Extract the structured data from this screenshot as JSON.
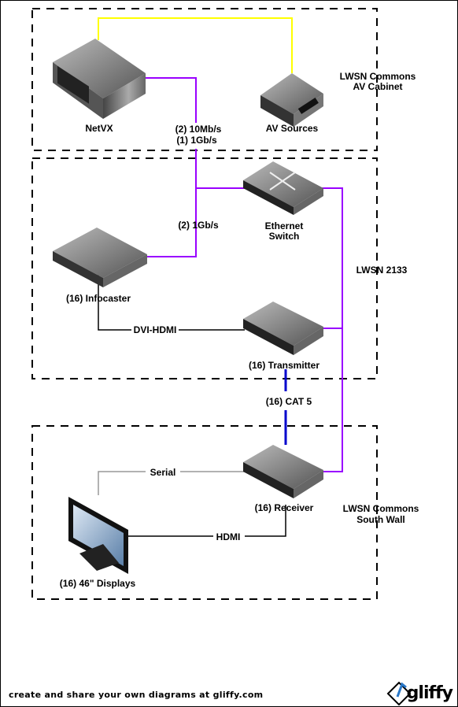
{
  "zones": {
    "av_cabinet": [
      "LWSN Commons",
      "AV Cabinet"
    ],
    "room_2133": "LWSN 2133",
    "south_wall": [
      "LWSN Commons",
      "South Wall"
    ]
  },
  "devices": {
    "netvx": "NetVX",
    "av_sources": "AV Sources",
    "ethernet_switch": [
      "Ethernet",
      "Switch"
    ],
    "infocaster": "(16)  Infocaster",
    "transmitter": "(16)  Transmitter",
    "receiver": "(16)  Receiver",
    "displays": "(16)  46\" Displays"
  },
  "connections": {
    "netvx_link": [
      "(2)  10Mb/s",
      "(1)  1Gb/s"
    ],
    "infocaster_link": "(2)  1Gb/s",
    "dvi_hdmi": "DVI-HDMI",
    "cat5": "(16)  CAT 5",
    "serial": "Serial",
    "hdmi": "HDMI"
  },
  "colors": {
    "ethernet": "#9900ff",
    "av": "#ffff00",
    "cat5": "#0000cc",
    "video": "#000000",
    "serial": "#999999"
  },
  "footer": {
    "text": "create and share your own diagrams at gliffy.com",
    "logo": "gliffy"
  }
}
